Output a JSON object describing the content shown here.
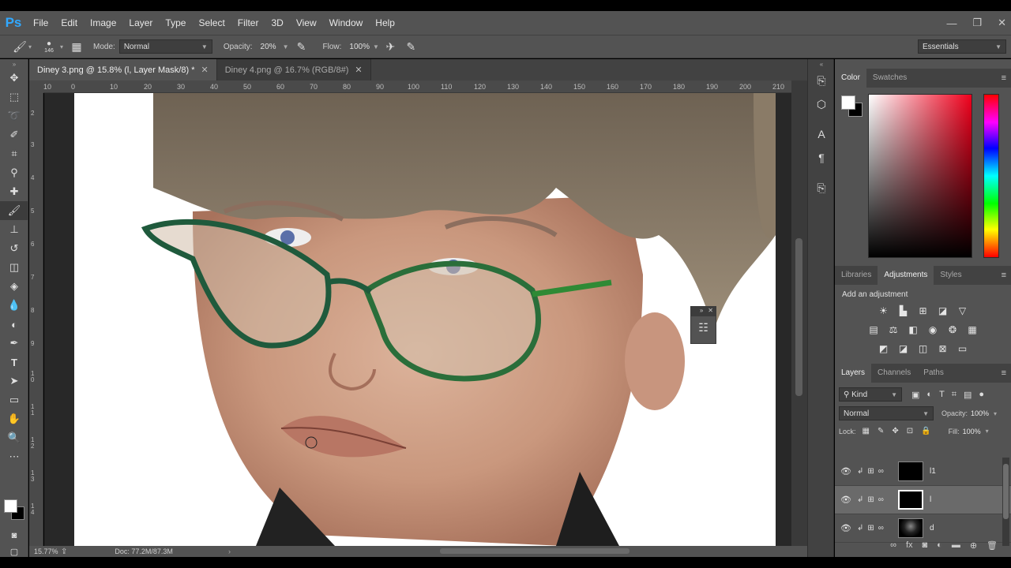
{
  "app": {
    "logo": "Ps"
  },
  "menu": [
    "File",
    "Edit",
    "Image",
    "Layer",
    "Type",
    "Select",
    "Filter",
    "3D",
    "View",
    "Window",
    "Help"
  ],
  "window_controls": {
    "minimize": "—",
    "restore": "❐",
    "close": "✕"
  },
  "options": {
    "brush_size": "146",
    "mode_label": "Mode:",
    "mode_value": "Normal",
    "opacity_label": "Opacity:",
    "opacity_value": "20%",
    "flow_label": "Flow:",
    "flow_value": "100%",
    "workspace": "Essentials"
  },
  "doc_tabs": [
    {
      "label": "Diney 3.png @ 15.8% (l, Layer Mask/8) *",
      "active": true
    },
    {
      "label": "Diney 4.png @ 16.7% (RGB/8#)",
      "active": false
    }
  ],
  "ruler_h": [
    "10",
    "0",
    "10",
    "20",
    "30",
    "40",
    "50",
    "60",
    "70",
    "80",
    "90",
    "100",
    "110",
    "120",
    "130",
    "140",
    "150",
    "160",
    "170",
    "180",
    "190",
    "200",
    "210"
  ],
  "ruler_v": [
    "2",
    "3",
    "4",
    "5",
    "6",
    "7",
    "8",
    "9",
    "10",
    "11",
    "12",
    "13",
    "14"
  ],
  "status": {
    "zoom": "15.77%",
    "doc": "Doc: 77.2M/87.3M"
  },
  "color_panel": {
    "tabs": [
      "Color",
      "Swatches"
    ],
    "fg_color": "#ffffff",
    "bg_color": "#000000"
  },
  "adjustments": {
    "tabs": [
      "Libraries",
      "Adjustments",
      "Styles"
    ],
    "title": "Add an adjustment"
  },
  "layers": {
    "tabs": [
      "Layers",
      "Channels",
      "Paths"
    ],
    "filter_kind": "Kind",
    "blend_mode": "Normal",
    "opacity_label": "Opacity:",
    "opacity_value": "100%",
    "lock_label": "Lock:",
    "fill_label": "Fill:",
    "fill_value": "100%",
    "items": [
      {
        "name": "l1",
        "selected": false
      },
      {
        "name": "l",
        "selected": true
      },
      {
        "name": "d",
        "selected": false
      }
    ]
  }
}
